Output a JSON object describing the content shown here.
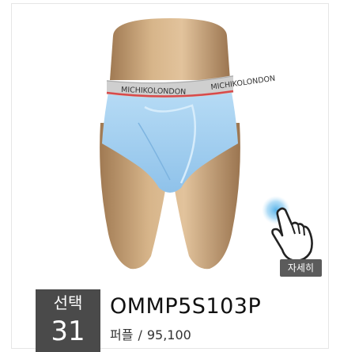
{
  "product": {
    "brand_text": "MICHIKOLONDON",
    "detail_label": "자세히",
    "choice_label": "선택",
    "choice_number": "31",
    "code": "OMMP5S103P",
    "color": "퍼플",
    "separator": "/",
    "price": "95,100"
  },
  "colors": {
    "garment": "#a9d3f2",
    "waistband": "#cfcfcf",
    "stripe": "#d84a4a",
    "badge_bg": "#5b5b5b",
    "choice_bg": "#4a4a4a",
    "touch_glow": "#4fb0e8"
  },
  "icons": {
    "detail": "pointing-hand-icon"
  }
}
